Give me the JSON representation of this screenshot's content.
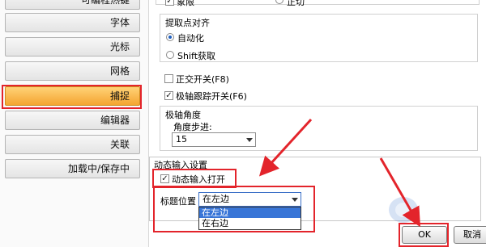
{
  "sidebar": {
    "items": [
      {
        "label": "可编程热键"
      },
      {
        "label": "字体"
      },
      {
        "label": "光标"
      },
      {
        "label": "网格"
      },
      {
        "label": "捕捉",
        "active": true
      },
      {
        "label": "编辑器"
      },
      {
        "label": "关联"
      },
      {
        "label": "加载中/保存中"
      }
    ]
  },
  "top_partial": {
    "option_a": "象限",
    "option_b": "正切"
  },
  "snap_alignment": {
    "title": "提取点对齐",
    "options": [
      {
        "label": "自动化",
        "selected": true
      },
      {
        "label": "Shift获取",
        "selected": false
      }
    ]
  },
  "orthogonal": {
    "label": "正交开关(F8)",
    "checked": false
  },
  "polar_tracking": {
    "label": "极轴跟踪开关(F6)",
    "checked": true
  },
  "polar_angle": {
    "title": "极轴角度",
    "step_label": "角度步进:",
    "step_value": "15"
  },
  "dynamic_input": {
    "title": "动态输入设置",
    "open_label": "动态输入打开",
    "open_checked": true,
    "title_pos_label": "标题位置",
    "title_pos_value": "在左边",
    "title_pos_options": [
      "在左边",
      "在右边"
    ]
  },
  "footer": {
    "ok_label": "OK",
    "cancel_label": "取消"
  },
  "colors": {
    "active_nav": "#f4a530",
    "annotation_red": "#e3242b",
    "selection_blue": "#3875d7"
  }
}
